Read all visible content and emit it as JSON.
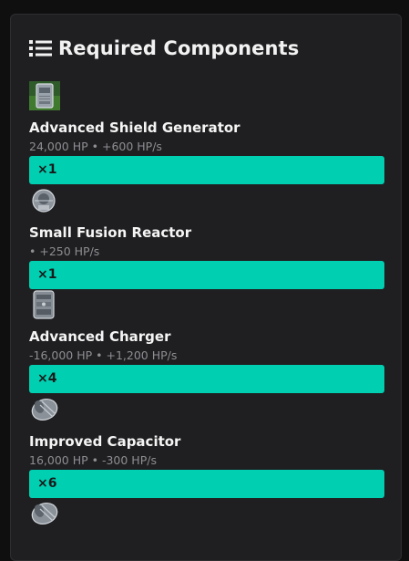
{
  "panel": {
    "title": "Required Components",
    "title_icon": "list-icon"
  },
  "components": [
    {
      "icon": "shield-generator-icon",
      "name": "Advanced Shield Generator",
      "stats": "24,000 HP • +600 HP/s",
      "quantity": "×1"
    },
    {
      "icon": "fusion-reactor-icon",
      "name": "Small Fusion Reactor",
      "stats": "• +250 HP/s",
      "quantity": "×1"
    },
    {
      "icon": "charger-icon",
      "name": "Advanced Charger",
      "stats": "-16,000 HP • +1,200 HP/s",
      "quantity": "×4"
    },
    {
      "icon": "capacitor-icon",
      "name": "Improved Capacitor",
      "stats": "16,000 HP • -300 HP/s",
      "quantity": "×6"
    },
    {
      "icon": "capacitor-icon"
    }
  ],
  "colors": {
    "accent": "#00cfb1",
    "panel_bg": "#1f1f21",
    "page_bg": "#0f0f10",
    "stat_text": "#8e8e93"
  }
}
